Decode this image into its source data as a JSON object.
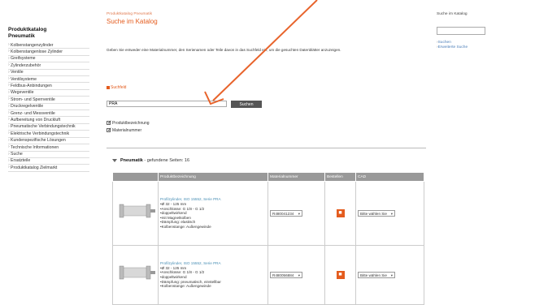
{
  "sidebar": {
    "title_line1": "Produktkatalog",
    "title_line2": "Pneumatik",
    "items": [
      "Kolbenstangenzylinder",
      "Kolbenstangenlose Zylinder",
      "Greifsysteme",
      "Zylinderzubehör",
      "Ventile",
      "Ventilsysteme",
      "Feldbus-Anbindungen",
      "Wegeventile",
      "Strom- und Sperrventile",
      "Druckregelventile",
      "Grenz- und Messventile",
      "Aufbereitung von Druckluft",
      "Pneumatische Verbindungstechnik",
      "Elektrische Verbindungstechnik",
      "Kundenspezifische Lösungen",
      "Technische Informationen",
      "Suche",
      "Ersatzteile",
      "Produktkatalog Zielmarkt"
    ]
  },
  "header": {
    "breadcrumb": "Produktkatalog Pneumatik",
    "title": "Suche im Katalog"
  },
  "intro": "Geben Sie entweder eine Materialnummer, den Serienamen oder Teile davon in das Suchfeld ein, um die gesuchten Datenblätter anzuzeigen.",
  "search": {
    "label": "Suchfeld",
    "value": "PRA",
    "button": "Suchen",
    "checkboxes": [
      "Produktbezeichnung",
      "Materialnummer"
    ]
  },
  "results": {
    "group": "Pneumatik",
    "suffix": " - gefundene Seiten: 16",
    "columns": [
      "",
      "Produktbezeichnung",
      "Materialnummer",
      "Bestellen",
      "CAD"
    ],
    "rows": [
      {
        "title": "Profilzylinder, ISO 15552, Serie PRA",
        "features": [
          "Ø 32 - 125 mm",
          "Anschlüsse: G 1/8 - G 1/2",
          "doppeltwirkend",
          "mit Magnetkolben",
          "Dämpfung: elastisch",
          "Kolbenstange: Außengewinde"
        ],
        "material": "R480041234",
        "cad": "Bitte wählen Sie"
      },
      {
        "title": "Profilzylinder, ISO 15552, Serie PRA",
        "features": [
          "Ø 32 - 125 mm",
          "Anschlüsse: G 1/8 - G 1/2",
          "doppeltwirkend",
          "Dämpfung: pneumatisch, einstellbar",
          "Kolbenstange: Außengewinde"
        ],
        "material": "R480056884",
        "cad": "Bitte wählen Sie"
      }
    ]
  },
  "right": {
    "label": "Suche im Katalog",
    "links": [
      "Suchen",
      "Erweiterte Suche"
    ]
  },
  "colors": {
    "accent": "#e45c1e",
    "arrow": "#e8642c"
  }
}
